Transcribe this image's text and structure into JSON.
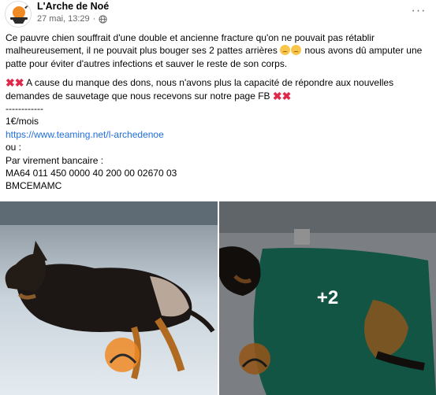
{
  "header": {
    "page_name": "L'Arche de Noé",
    "date": "27 mai, 13:29",
    "separator": "·",
    "audience_icon": "globe-icon",
    "more_icon": "more-options-icon",
    "more_label": "···"
  },
  "post": {
    "paragraph1_part1": "Ce pauvre chien souffrait d'une double et ancienne fracture qu'on ne pouvait pas rétablir malheureusement, il ne pouvait plus bouger ses 2 pattes arrières",
    "paragraph1_part2": " nous avons dû amputer une patte pour éviter d'autres infections et sauver le reste de son corps.",
    "paragraph2_text": " A cause du manque des dons, nous n'avons plus la capacité de répondre aux nouvelles demandes de sauvetage que nous recevons sur notre page FB",
    "separator_line": "------------",
    "donation_amount": "1€/mois",
    "donation_link": "https://www.teaming.net/l-archedenoe",
    "or_text": " ou :",
    "transfer_label": "Par virement bancaire :",
    "iban": "MA64 011 450 0000 40 200 00 02670 03",
    "bic": "BMCEMAMC"
  },
  "gallery": {
    "more_photos_count": "+2"
  },
  "colors": {
    "link": "#216fdb",
    "secondary_text": "#65676b",
    "cross_mark": "#e0284a"
  }
}
